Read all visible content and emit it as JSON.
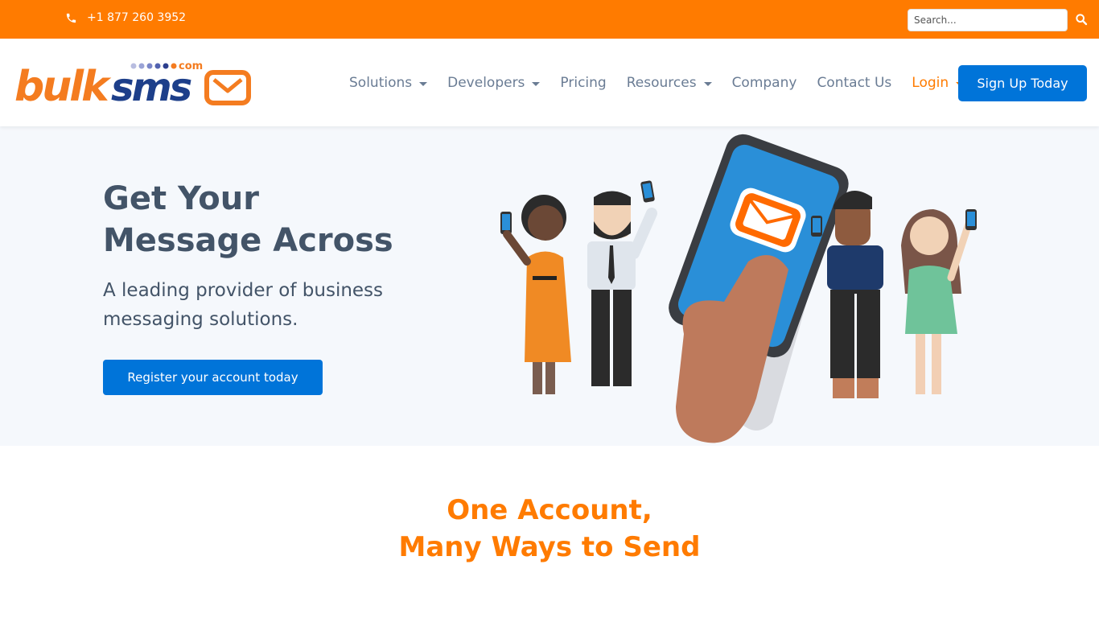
{
  "topbar": {
    "phone_icon": "phone-icon",
    "phone_number": "+1 877 260 3952",
    "search_placeholder": "Search...",
    "search_value": "",
    "search_icon": "search-icon"
  },
  "header": {
    "logo_text": "bulksms",
    "logo_suffix": "com",
    "nav": [
      {
        "label": "Solutions",
        "dropdown": true
      },
      {
        "label": "Developers",
        "dropdown": true
      },
      {
        "label": "Pricing",
        "dropdown": false
      },
      {
        "label": "Resources",
        "dropdown": true
      },
      {
        "label": "Company",
        "dropdown": false
      },
      {
        "label": "Contact Us",
        "dropdown": false
      },
      {
        "label": "Login",
        "dropdown": true
      }
    ],
    "signup_label": "Sign Up Today"
  },
  "hero": {
    "title_line1": "Get Your",
    "title_line2": "Message Across",
    "subtitle": "A leading provider of business messaging solutions.",
    "cta_label": "Register your account today"
  },
  "section": {
    "title_line1": "One Account,",
    "title_line2": "Many Ways to Send"
  },
  "colors": {
    "brand_orange": "#ff7b00",
    "brand_blue": "#0074d9",
    "nav_text": "#6a7c94",
    "heading_text": "#435468",
    "hero_bg": "#f5f8fc"
  }
}
